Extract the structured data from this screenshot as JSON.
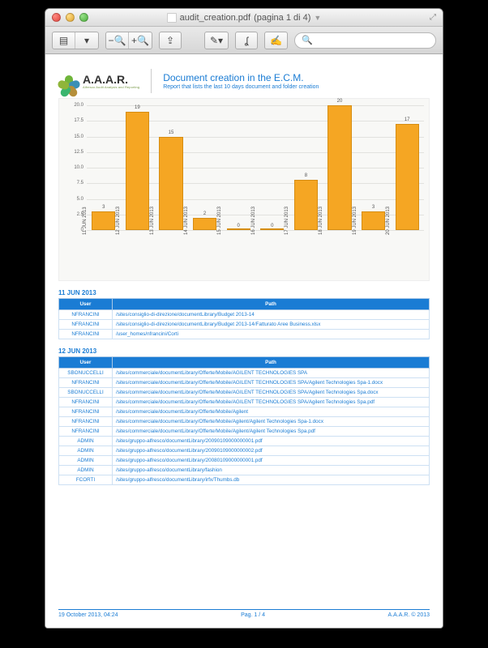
{
  "window": {
    "filename": "audit_creation.pdf",
    "title_suffix": "(pagina 1 di 4)"
  },
  "report": {
    "logo_name": "A.A.A.R.",
    "logo_tagline": "Alfresco Audit Analysis and Reporting",
    "title": "Document creation in the E.C.M.",
    "subtitle": "Report that lists the last 10 days document and folder creation"
  },
  "chart_data": {
    "type": "bar",
    "title": "",
    "xlabel": "",
    "ylabel": "",
    "categories": [
      "11 JUN 2013",
      "12 JUN 2013",
      "13 JUN 2013",
      "14 JUN 2013",
      "15 JUN 2013",
      "16 JUN 2013",
      "17 JUN 2013",
      "18 JUN 2013",
      "19 JUN 2013",
      "20 JUN 2013"
    ],
    "values": [
      3,
      19,
      15,
      2,
      0,
      0,
      8,
      20,
      3,
      17
    ],
    "ylim": [
      0,
      20
    ],
    "yticks": [
      0,
      2.5,
      5.0,
      7.5,
      10.0,
      12.5,
      15.0,
      17.5,
      20.0
    ],
    "grid": true
  },
  "sections": [
    {
      "date_label": "11 JUN 2013",
      "columns": [
        "User",
        "Path"
      ],
      "rows": [
        {
          "user": "NFRANCINI",
          "path": "/sites/consiglio-di-direzione/documentLibrary/Budget 2013-14"
        },
        {
          "user": "NFRANCINI",
          "path": "/sites/consiglio-di-direzione/documentLibrary/Budget 2013-14/Fatturato Aree Business.xlsx"
        },
        {
          "user": "NFRANCINI",
          "path": "/user_homes/nfrancini/Corti"
        }
      ]
    },
    {
      "date_label": "12 JUN 2013",
      "columns": [
        "User",
        "Path"
      ],
      "rows": [
        {
          "user": "SBONUCCELLI",
          "path": "/sites/commerciale/documentLibrary/Offerte/Mobile/AGILENT TECHNOLOGIES SPA"
        },
        {
          "user": "NFRANCINI",
          "path": "/sites/commerciale/documentLibrary/Offerte/Mobile/AGILENT TECHNOLOGIES SPA/Agilent Technologies Spa-1.docx"
        },
        {
          "user": "SBONUCCELLI",
          "path": "/sites/commerciale/documentLibrary/Offerte/Mobile/AGILENT TECHNOLOGIES SPA/Agilent Technologies Spa.docx"
        },
        {
          "user": "NFRANCINI",
          "path": "/sites/commerciale/documentLibrary/Offerte/Mobile/AGILENT TECHNOLOGIES SPA/Agilent Technologies Spa.pdf"
        },
        {
          "user": "NFRANCINI",
          "path": "/sites/commerciale/documentLibrary/Offerte/Mobile/Agilent"
        },
        {
          "user": "NFRANCINI",
          "path": "/sites/commerciale/documentLibrary/Offerte/Mobile/Agilent/Agilent Technologies Spa-1.docx"
        },
        {
          "user": "NFRANCINI",
          "path": "/sites/commerciale/documentLibrary/Offerte/Mobile/Agilent/Agilent Technologies Spa.pdf"
        },
        {
          "user": "ADMIN",
          "path": "/sites/gruppo-alfresco/documentLibrary/20090109000000001.pdf"
        },
        {
          "user": "ADMIN",
          "path": "/sites/gruppo-alfresco/documentLibrary/20090109000000002.pdf"
        },
        {
          "user": "ADMIN",
          "path": "/sites/gruppo-alfresco/documentLibrary/20080109000000001.pdf"
        },
        {
          "user": "ADMIN",
          "path": "/sites/gruppo-alfresco/documentLibrary/fashion"
        },
        {
          "user": "FCORTI",
          "path": "/sites/gruppo-alfresco/documentLibrary/irfx/Thumbs.db"
        }
      ]
    }
  ],
  "footer": {
    "left": "19 October 2013, 04:24",
    "center": "Pag. 1 / 4",
    "right": "A.A.A.R. © 2013"
  }
}
